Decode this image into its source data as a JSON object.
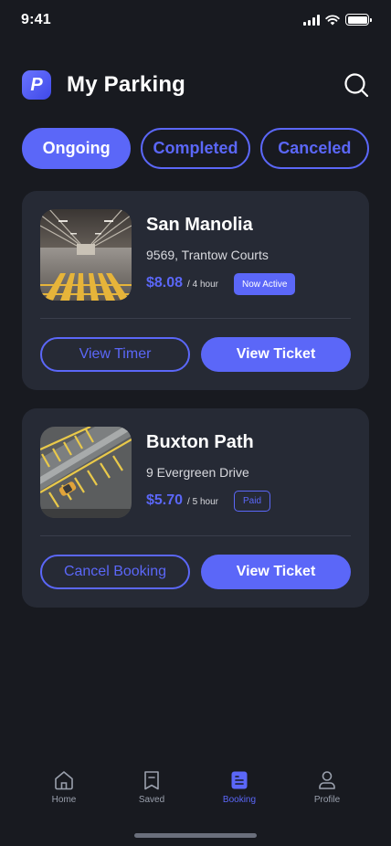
{
  "status_bar": {
    "time": "9:41"
  },
  "header": {
    "logo_letter": "P",
    "title": "My Parking"
  },
  "tabs": [
    {
      "label": "Ongoing",
      "active": true
    },
    {
      "label": "Completed",
      "active": false
    },
    {
      "label": "Canceled",
      "active": false
    }
  ],
  "bookings": [
    {
      "name": "San Manolia",
      "address": "9569, Trantow Courts",
      "price": "$8.08",
      "duration": "/ 4 hour",
      "status": "Now Active",
      "secondary_action": "View Timer",
      "primary_action": "View Ticket"
    },
    {
      "name": "Buxton Path",
      "address": "9 Evergreen Drive",
      "price": "$5.70",
      "duration": "/ 5 hour",
      "status": "Paid",
      "secondary_action": "Cancel Booking",
      "primary_action": "View Ticket"
    }
  ],
  "bottom_nav": [
    {
      "label": "Home",
      "icon": "home-icon",
      "active": false
    },
    {
      "label": "Saved",
      "icon": "bookmark-icon",
      "active": false
    },
    {
      "label": "Booking",
      "icon": "booking-document-icon",
      "active": true
    },
    {
      "label": "Profile",
      "icon": "profile-icon",
      "active": false
    }
  ],
  "colors": {
    "background": "#181a20",
    "card": "#262a35",
    "accent": "#5b67f8",
    "muted_text": "#9aa0ad"
  }
}
